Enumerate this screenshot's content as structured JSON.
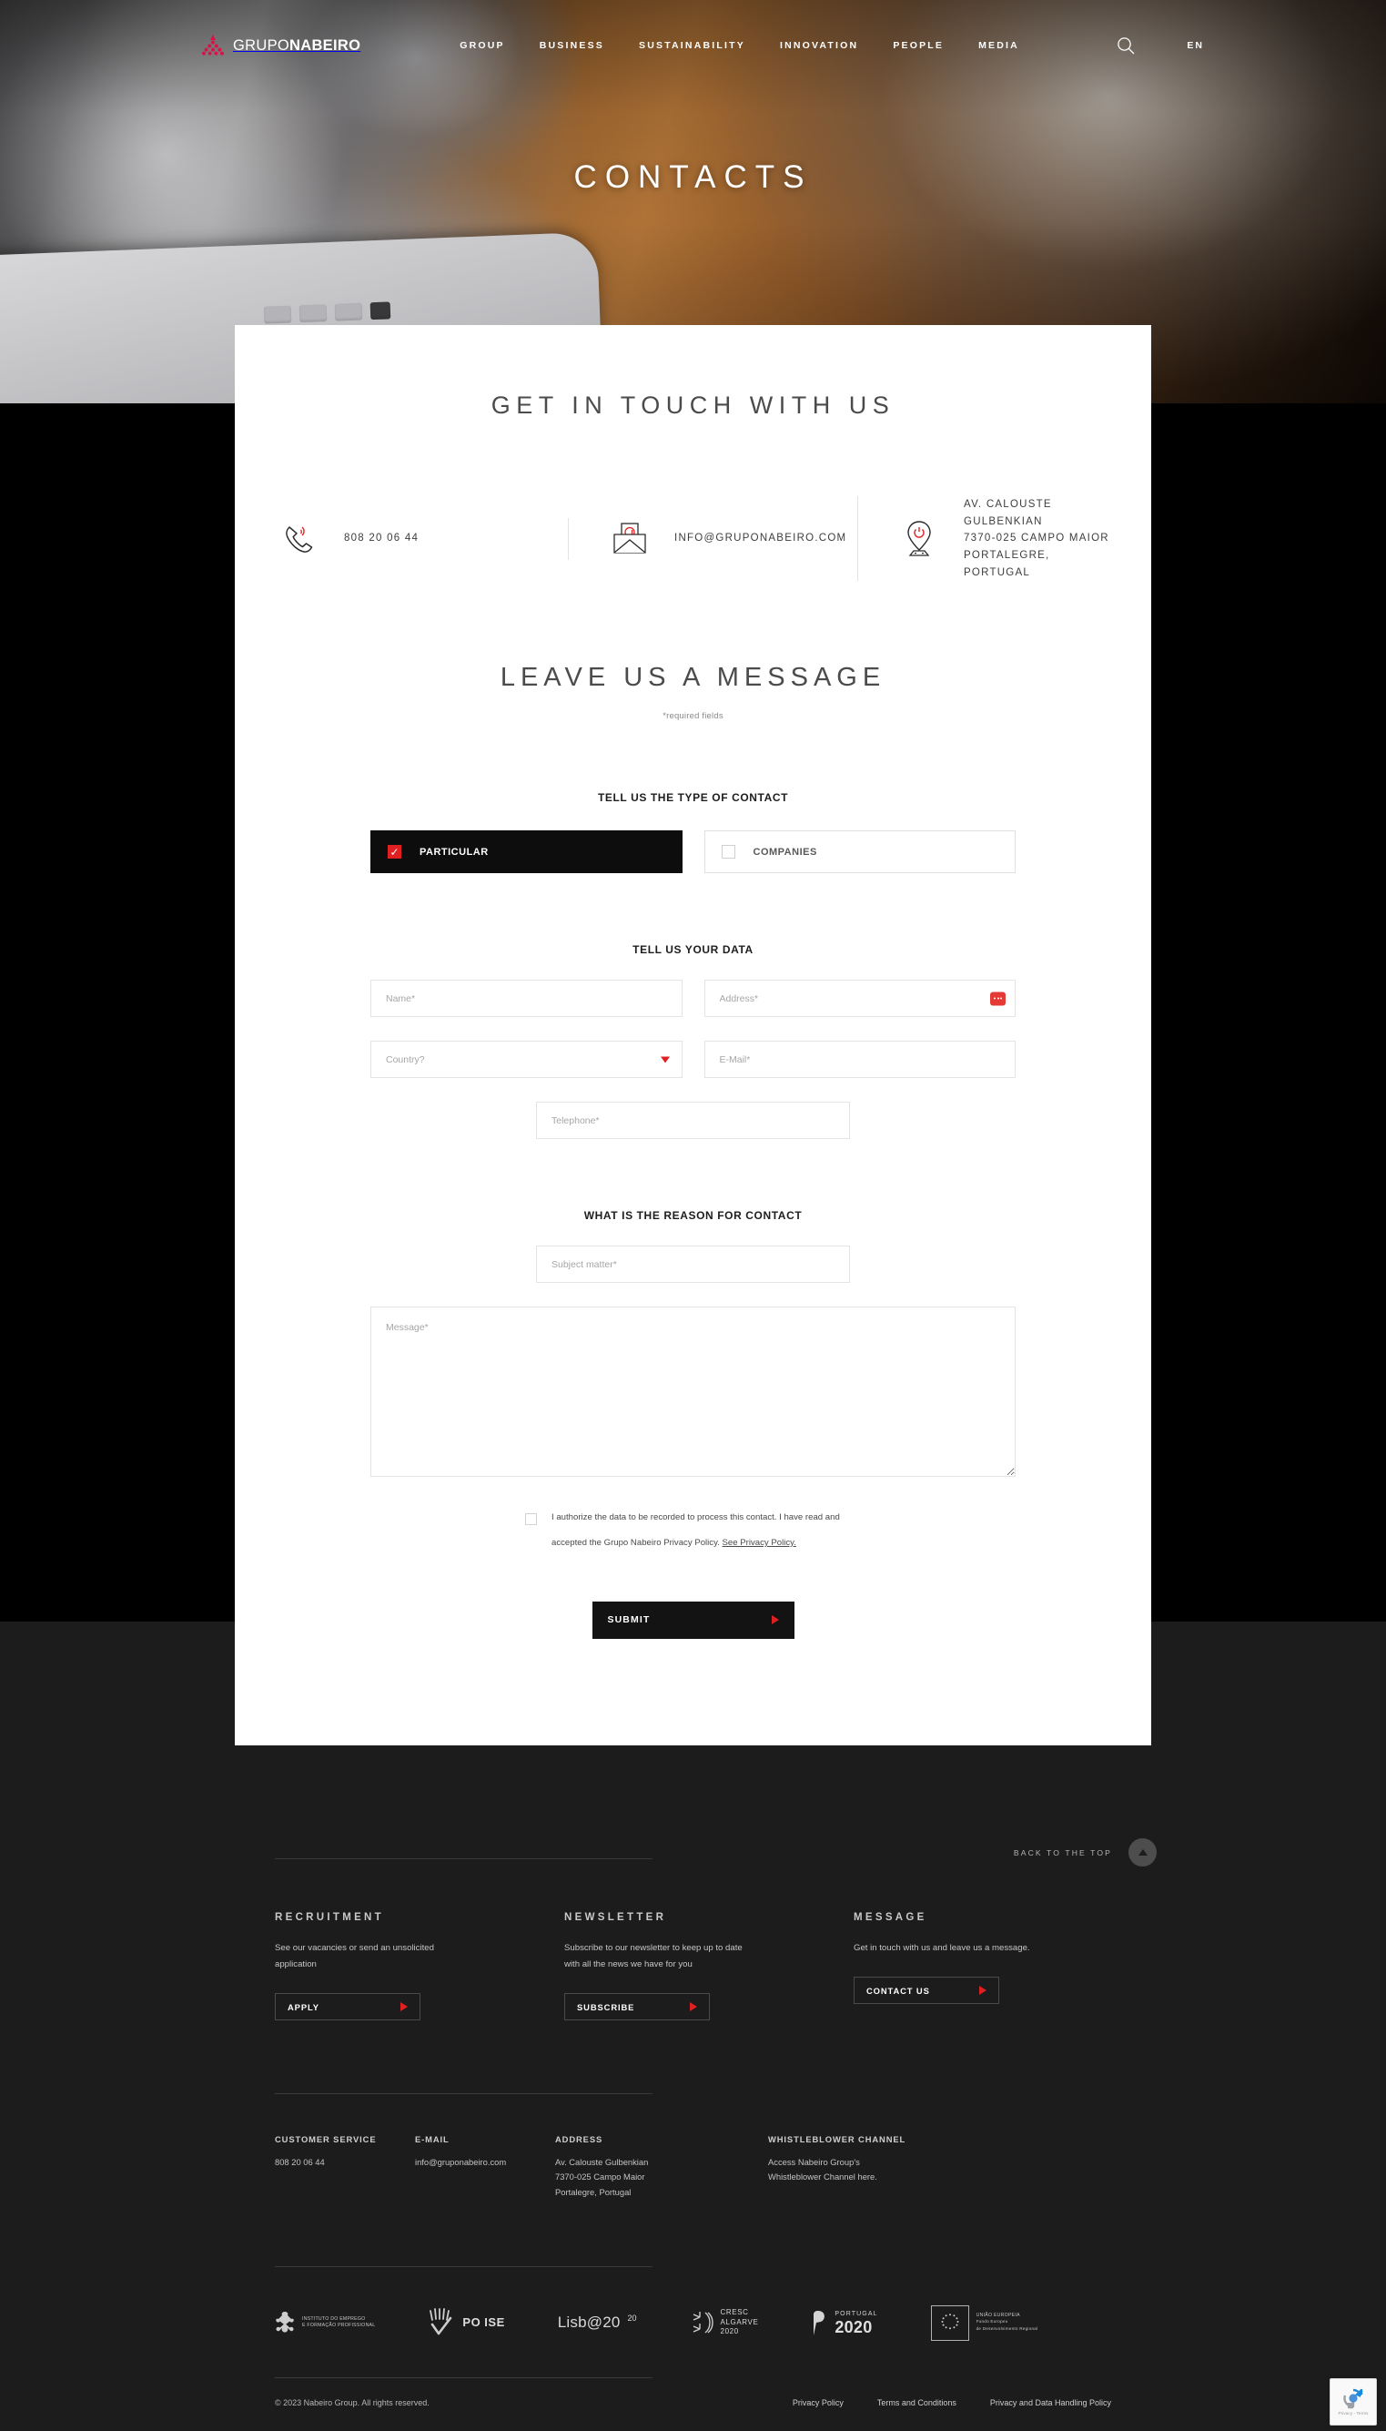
{
  "header": {
    "brand_first": "GRUPO",
    "brand_second": "NABEIRO",
    "nav": [
      {
        "label": "GROUP"
      },
      {
        "label": "BUSINESS"
      },
      {
        "label": "SUSTAINABILITY"
      },
      {
        "label": "INNOVATION"
      },
      {
        "label": "PEOPLE"
      },
      {
        "label": "MEDIA"
      }
    ],
    "search_icon": "search-icon",
    "language": "EN"
  },
  "hero": {
    "title": "CONTACTS"
  },
  "intro": {
    "heading": "GET IN TOUCH WITH US"
  },
  "contacts": [
    {
      "icon": "phone-icon",
      "text": "808 20 06 44"
    },
    {
      "icon": "envelope-icon",
      "text": "INFO@GRUPONABEIRO.COM"
    },
    {
      "icon": "map-pin-icon",
      "line1": "AV. CALOUSTE GULBENKIAN",
      "line2": "7370-025 CAMPO MAIOR",
      "line3": "PORTALEGRE, PORTUGAL"
    }
  ],
  "form": {
    "heading": "LEAVE US A MESSAGE",
    "required_note": "*required fields",
    "type_heading": "TELL US THE TYPE OF CONTACT",
    "type_options": [
      {
        "label": "PARTICULAR",
        "selected": true
      },
      {
        "label": "COMPANIES",
        "selected": false
      }
    ],
    "data_heading": "TELL US YOUR DATA",
    "fields": {
      "name": {
        "placeholder": "Name*",
        "value": ""
      },
      "address": {
        "placeholder": "Address*",
        "value": ""
      },
      "country": {
        "placeholder": "Country?",
        "value": ""
      },
      "email": {
        "placeholder": "E-Mail*",
        "value": ""
      },
      "telephone": {
        "placeholder": "Telephone*",
        "value": ""
      },
      "subject": {
        "placeholder": "Subject matter*",
        "value": ""
      },
      "message": {
        "placeholder": "Message*",
        "value": ""
      }
    },
    "reason_heading": "WHAT IS THE REASON FOR CONTACT",
    "consent_text": "I authorize the data to be recorded to process this contact. I have read and accepted the Grupo Nabeiro Privacy Policy.",
    "consent_link": "See Privacy Policy.",
    "submit_label": "SUBMIT"
  },
  "footer": {
    "back_to_top": "BACK TO THE TOP",
    "columns": [
      {
        "title": "RECRUITMENT",
        "text": "See our vacancies or send an unsolicited application",
        "button": "APPLY"
      },
      {
        "title": "NEWSLETTER",
        "text": "Subscribe to our newsletter to keep up to date with all the news we have for you",
        "button": "SUBSCRIBE"
      },
      {
        "title": "MESSAGE",
        "text": "Get in touch with us and leave us a message.",
        "button": "CONTACT US"
      }
    ],
    "info": [
      {
        "title": "CUSTOMER SERVICE",
        "lines": [
          "808 20 06 44"
        ]
      },
      {
        "title": "E-MAIL",
        "lines": [
          "info@gruponabeiro.com"
        ]
      },
      {
        "title": "ADDRESS",
        "lines": [
          "Av. Calouste Gulbenkian",
          "7370-025 Campo Maior",
          "Portalegre, Portugal"
        ]
      },
      {
        "title": "WHISTLEBLOWER CHANNEL",
        "lines": [
          "Access Nabeiro Group's",
          "Whistleblower Channel here."
        ]
      }
    ],
    "partner_logos": [
      {
        "name": "iefp-logo",
        "caption": "INSTITUTO DO EMPREGO\nE FORMAÇÃO PROFISSIONAL"
      },
      {
        "name": "po-ise-logo",
        "caption": "PO ISE"
      },
      {
        "name": "lisboa2020-logo",
        "caption": "Lisb@20"
      },
      {
        "name": "cresc-algarve-2020-logo",
        "caption": "CRESC ALGARVE 2020"
      },
      {
        "name": "portugal2020-logo",
        "caption": "PORTUGAL 2020"
      },
      {
        "name": "uniao-europeia-logo",
        "caption": "UNIÃO EUROPEIA\nFundo Europeu\nde Desenvolvimento Regional"
      }
    ],
    "copyright": "© 2023 Nabeiro Group. All rights reserved.",
    "legal_links": [
      {
        "label": "Privacy Policy"
      },
      {
        "label": "Terms and Conditions"
      },
      {
        "label": "Privacy and Data Handling Policy"
      }
    ]
  },
  "recaptcha": {
    "label": "Privacy - Terms"
  },
  "colors": {
    "accent_red": "#e02020",
    "dark": "#1c1c1c",
    "panel": "#ffffff"
  }
}
